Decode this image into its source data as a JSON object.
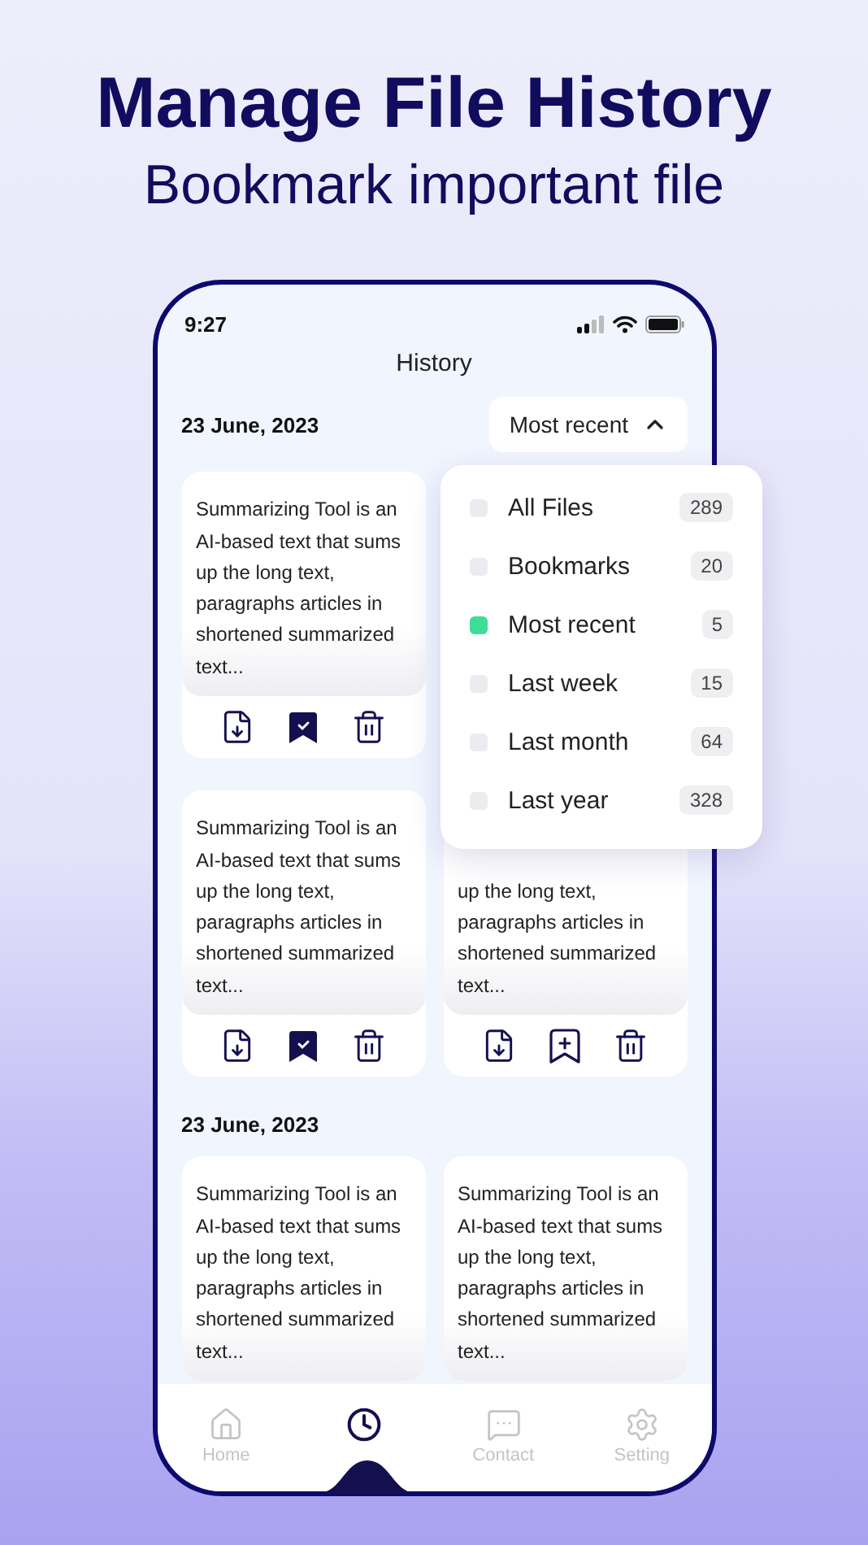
{
  "header": {
    "title": "Manage File History",
    "subtitle": "Bookmark important file"
  },
  "status_bar": {
    "time": "9:27"
  },
  "screen_title": "History",
  "sort_button": {
    "label": "Most recent",
    "expanded": true
  },
  "sort_menu": [
    {
      "label": "All Files",
      "count": "289",
      "selected": false
    },
    {
      "label": "Bookmarks",
      "count": "20",
      "selected": false
    },
    {
      "label": "Most recent",
      "count": "5",
      "selected": true
    },
    {
      "label": "Last week",
      "count": "15",
      "selected": false
    },
    {
      "label": "Last month",
      "count": "64",
      "selected": false
    },
    {
      "label": "Last year",
      "count": "328",
      "selected": false
    }
  ],
  "sections": [
    {
      "date": "23 June, 2023",
      "cards": [
        {
          "text": "Summarizing Tool is an AI-based text that sums up the long text, paragraphs articles in shortened summarized text...",
          "bookmarked": true
        },
        {
          "text": "Summarizing Tool is an AI-based text that sums up the long text, paragraphs articles in shortened summarized text...",
          "bookmarked": true
        },
        {
          "text": "up the long text, paragraphs articles in shortened summarized text...",
          "bookmarked": false
        }
      ]
    },
    {
      "date": "23 June, 2023",
      "cards": [
        {
          "text": "Summarizing Tool is an AI-based text that sums up the long text, paragraphs articles in shortened summarized text..."
        },
        {
          "text": "Summarizing Tool is an AI-based text that sums up the long text, paragraphs articles in shortened summarized text..."
        }
      ]
    }
  ],
  "nav": [
    {
      "label": "Home",
      "selected": false
    },
    {
      "selected": true
    },
    {
      "label": "Contact",
      "selected": false
    },
    {
      "label": "Setting",
      "selected": false
    }
  ]
}
